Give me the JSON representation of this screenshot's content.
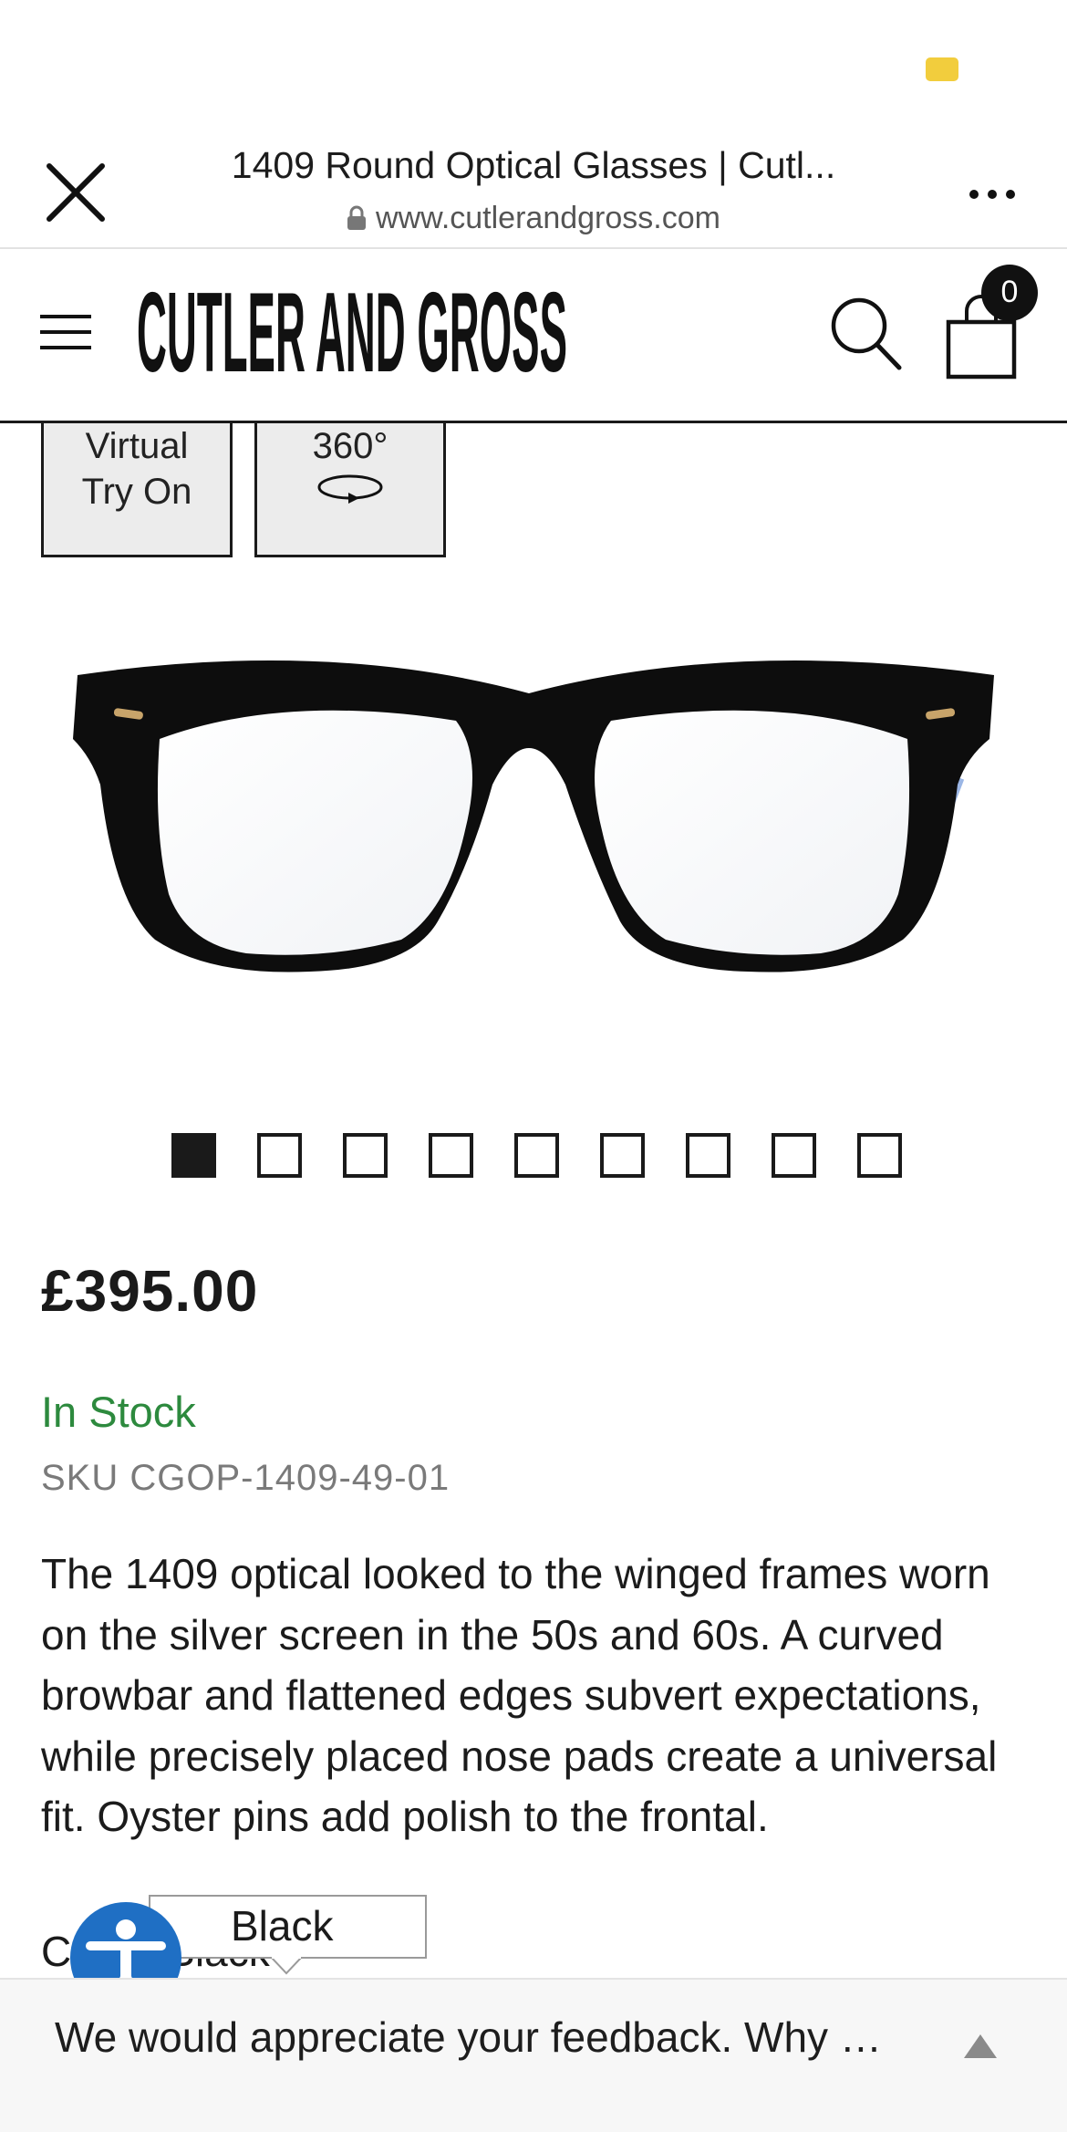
{
  "browser": {
    "page_title": "1409 Round Optical Glasses | Cutl...",
    "url": "www.cutlerandgross.com"
  },
  "header": {
    "logo_text": "CUTLER AND GROSS",
    "cart_count": "0"
  },
  "tryon": {
    "virtual_line1": "Virtual",
    "virtual_line2": "Try On",
    "rotate_label": "360°"
  },
  "carousel": {
    "total_slides": 9,
    "active_index": 0
  },
  "product": {
    "price": "£395.00",
    "stock_status": "In Stock",
    "sku": "SKU CGOP-1409-49-01",
    "description": "The 1409 optical looked to the winged frames worn on the silver screen in the 50s and 60s. A curved browbar and flattened edges subvert expectations, while precisely placed nose pads create a universal fit. Oyster pins add polish to the frontal.",
    "colour_prefix": "C",
    "colour_value": "Black"
  },
  "tooltip": {
    "text": "Black"
  },
  "feedback": {
    "text": "We would appreciate your feedback. Why …"
  },
  "colors": {
    "in_stock": "#2d8a3e",
    "accessibility_blue": "#1f6fc4",
    "status_indicator": "#f2cd3d"
  },
  "icons": [
    "close-icon",
    "lock-icon",
    "more-icon",
    "menu-icon",
    "search-icon",
    "cart-icon",
    "rotate-360-icon",
    "accessibility-icon",
    "chevron-up-icon"
  ]
}
